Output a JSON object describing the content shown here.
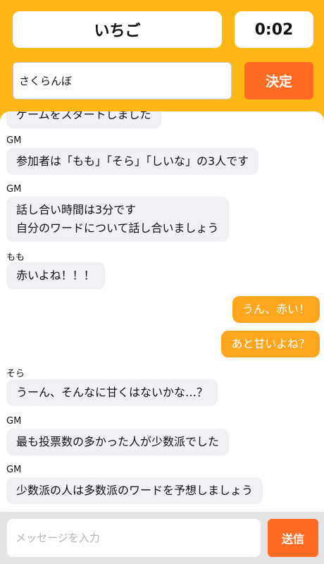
{
  "header": {
    "word": "いちご",
    "timer": "0:02"
  },
  "answer": {
    "value": "さくらんぼ",
    "decide_label": "決定"
  },
  "messages": [
    {
      "sender": "",
      "lines": [
        "ゲームをスタートしました"
      ],
      "mine": false
    },
    {
      "sender": "GM",
      "lines": [
        "参加者は「もも」「そら」「しいな」の3人です"
      ],
      "mine": false
    },
    {
      "sender": "GM",
      "lines": [
        "話し合い時間は3分です",
        "自分のワードについて話し合いましょう"
      ],
      "mine": false
    },
    {
      "sender": "もも",
      "lines": [
        "赤いよね！！！"
      ],
      "mine": false
    },
    {
      "sender": "",
      "lines": [
        "うん、赤い！"
      ],
      "mine": true
    },
    {
      "sender": "",
      "lines": [
        "あと甘いよね？"
      ],
      "mine": true
    },
    {
      "sender": "そら",
      "lines": [
        "うーん、そんなに甘くはないかな…？"
      ],
      "mine": false
    },
    {
      "sender": "GM",
      "lines": [
        "最も投票数の多かった人が少数派でした"
      ],
      "mine": false
    },
    {
      "sender": "GM",
      "lines": [
        "少数派の人は多数派のワードを予想しましょう"
      ],
      "mine": false
    }
  ],
  "composer": {
    "placeholder": "メッセージを入力",
    "send_label": "送信"
  },
  "colors": {
    "background": "#FDB714",
    "accent_button": "#FF6B22",
    "my_bubble": "#FFA61E",
    "other_bubble": "#F0F0F5"
  }
}
